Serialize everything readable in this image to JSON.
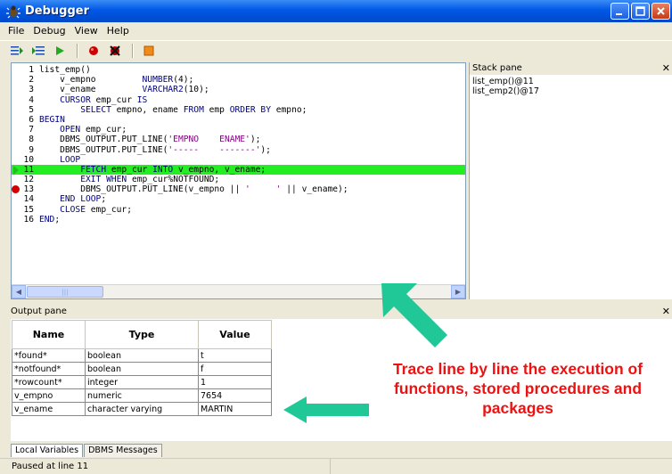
{
  "window": {
    "title": "Debugger"
  },
  "menu": [
    "File",
    "Debug",
    "View",
    "Help"
  ],
  "toolbar": {
    "buttons": [
      "step-into-icon",
      "step-over-icon",
      "continue-icon",
      "set-breakpoint-icon",
      "clear-breakpoints-icon",
      "stop-icon"
    ]
  },
  "editor": {
    "current_line": 11,
    "breakpoint_line": 13,
    "lines": [
      {
        "n": "1",
        "text": "list_emp()"
      },
      {
        "n": "2",
        "text": "    v_empno         NUMBER(4);"
      },
      {
        "n": "3",
        "text": "    v_ename         VARCHAR2(10);"
      },
      {
        "n": "4",
        "text": "    CURSOR emp_cur IS"
      },
      {
        "n": "5",
        "text": "        SELECT empno, ename FROM emp ORDER BY empno;"
      },
      {
        "n": "6",
        "text": "BEGIN"
      },
      {
        "n": "7",
        "text": "    OPEN emp_cur;"
      },
      {
        "n": "8",
        "text": "    DBMS_OUTPUT.PUT_LINE('EMPNO    ENAME');"
      },
      {
        "n": "9",
        "text": "    DBMS_OUTPUT.PUT_LINE('-----    -------');"
      },
      {
        "n": "10",
        "text": "    LOOP"
      },
      {
        "n": "11",
        "text": "        FETCH emp_cur INTO v_empno, v_ename;"
      },
      {
        "n": "12",
        "text": "        EXIT WHEN emp_cur%NOTFOUND;"
      },
      {
        "n": "13",
        "text": "        DBMS_OUTPUT.PUT_LINE(v_empno || '     ' || v_ename);"
      },
      {
        "n": "14",
        "text": "    END LOOP;"
      },
      {
        "n": "15",
        "text": "    CLOSE emp_cur;"
      },
      {
        "n": "16",
        "text": "END;"
      }
    ]
  },
  "stack_pane": {
    "title": "Stack pane",
    "items": [
      "list_emp()@11",
      "list_emp2()@17"
    ]
  },
  "output_pane": {
    "title": "Output pane",
    "columns": [
      "Name",
      "Type",
      "Value"
    ],
    "rows": [
      [
        "*found*",
        "boolean",
        "t"
      ],
      [
        "*notfound*",
        "boolean",
        "f"
      ],
      [
        "*rowcount*",
        "integer",
        "1"
      ],
      [
        "v_empno",
        "numeric",
        "7654"
      ],
      [
        "v_ename",
        "character varying",
        "MARTIN"
      ]
    ]
  },
  "tabs": [
    "Local Variables",
    "DBMS Messages"
  ],
  "status": "Paused at line 11",
  "annotation": "Trace line by line the execution of functions, stored procedures and packages",
  "colors": {
    "current_line": "#22ee22",
    "annotation_text": "#ee1111",
    "arrow": "#1fc896"
  }
}
